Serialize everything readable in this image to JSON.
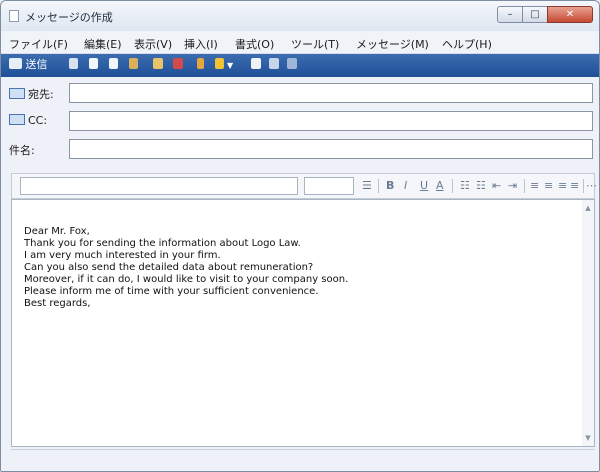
{
  "window": {
    "title": "メッセージの作成",
    "controls": {
      "minimize": "–",
      "maximize": "□",
      "close": "✕"
    }
  },
  "menu": [
    "ファイル(F)",
    "編集(E)",
    "表示(V)",
    "挿入(I)",
    "書式(O)",
    "ツール(T)",
    "メッセージ(M)",
    "ヘルプ(H)"
  ],
  "toolbar": {
    "send_label": "送信",
    "icons": [
      "send-icon",
      "cut-icon",
      "copy-icon",
      "paste-icon",
      "undo-icon",
      "check-names-icon",
      "spelling-icon",
      "attach-icon",
      "priority-icon",
      "sign-icon",
      "encrypt-icon",
      "offline-icon"
    ]
  },
  "fields": {
    "to_label": "宛先:",
    "cc_label": "CC:",
    "subject_label": "件名:",
    "to_value": "",
    "cc_value": "",
    "subject_value": ""
  },
  "format": {
    "font_value": "",
    "size_value": "",
    "bold": "B",
    "italic": "I",
    "underline": "U",
    "font_color": "A"
  },
  "message": {
    "lines": [
      "Dear Mr. Fox,",
      "Thank you for sending the information about Logo Law.",
      "I am very much interested in your firm.",
      "Can you also send the detailed data about remuneration?",
      "Moreover, if it can do, I would like to visit to your company soon.",
      "Please inform me of time with your sufficient convenience.",
      "Best regards,"
    ]
  },
  "colors": {
    "toolbar": "#2a5aa2",
    "close_button": "#c54a32"
  }
}
